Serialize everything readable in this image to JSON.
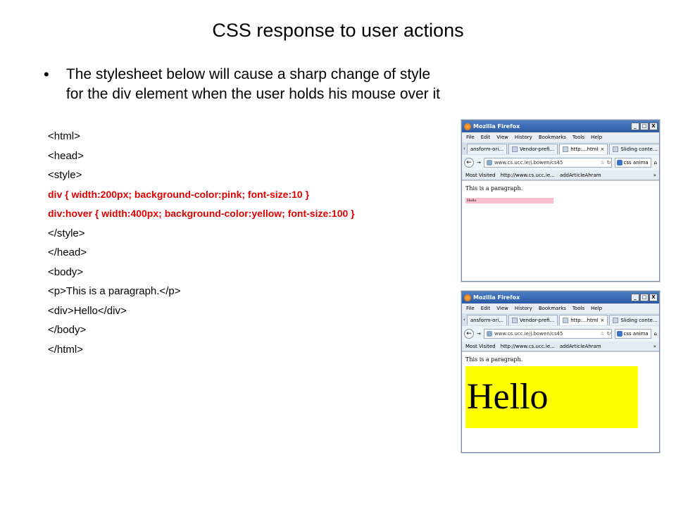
{
  "title": "CSS response to user actions",
  "bullet": {
    "symbol": "•",
    "text": "The stylesheet below will cause a sharp change of style for the div element when the user holds his mouse over it"
  },
  "code": [
    {
      "text": "<html>",
      "style": "normal"
    },
    {
      "text": "<head>",
      "style": "normal"
    },
    {
      "text": "<style>",
      "style": "normal"
    },
    {
      "text": "div { width:200px; background-color:pink; font-size:10 }",
      "style": "red"
    },
    {
      "text": "div:hover { width:400px; background-color:yellow; font-size:100 }",
      "style": "red"
    },
    {
      "text": "</style>",
      "style": "normal"
    },
    {
      "text": "</head>",
      "style": "normal"
    },
    {
      "text": "<body>",
      "style": "normal"
    },
    {
      "text": "<p>This is a paragraph.</p>",
      "style": "normal"
    },
    {
      "text": "<div>Hello</div>",
      "style": "normal"
    },
    {
      "text": "</body>",
      "style": "normal"
    },
    {
      "text": "</html>",
      "style": "normal"
    }
  ],
  "browser": {
    "window_title": "Mozilla Firefox",
    "win_buttons": [
      "_",
      "□",
      "X"
    ],
    "menu": [
      "File",
      "Edit",
      "View",
      "History",
      "Bookmarks",
      "Tools",
      "Help"
    ],
    "tabs": [
      "ansform-ori...",
      "Vendor-prefi...",
      "http:...html",
      "Sliding conte..."
    ],
    "tab_close": "×",
    "tab_more": "›",
    "tab_add": "+",
    "url": "www.cs.ucc.ie/j.bowen/cs45",
    "search": "css anima",
    "bookmarks": [
      "Most Visited",
      "http://www.cs.ucc.ie...",
      "addArticleAhram"
    ],
    "bookmarks_more": "»",
    "paragraph": "This is a paragraph.",
    "hello": "Hello"
  },
  "colors": {
    "pink": "#ffc0cb",
    "yellow": "#ffff00",
    "code_red": "#e00000"
  },
  "icons": [
    "back-arrow-icon",
    "star-icon",
    "reload-icon",
    "home-icon",
    "search-icon",
    "firefox-logo-icon"
  ]
}
